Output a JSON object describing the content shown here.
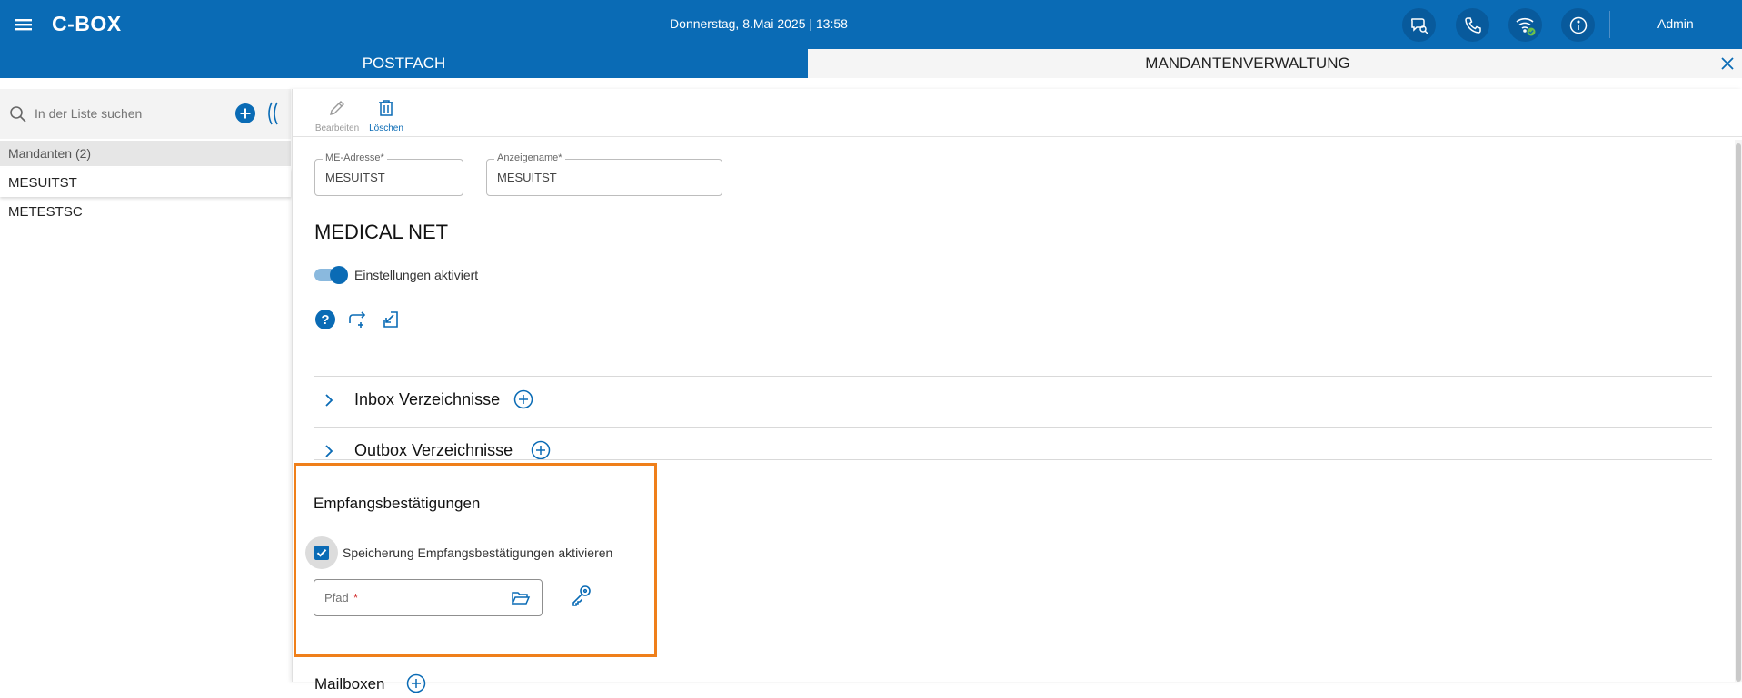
{
  "header": {
    "app_title": "C-BOX",
    "datetime": "Donnerstag, 8.Mai 2025 | 13:58",
    "user": "Admin",
    "icons": [
      "menu-icon",
      "chat-search-icon",
      "phone-icon",
      "wifi-connected-icon",
      "info-icon"
    ]
  },
  "tabs": [
    {
      "label": "POSTFACH",
      "active": false
    },
    {
      "label": "MANDANTENVERWALTUNG",
      "active": true
    }
  ],
  "sidebar": {
    "search_placeholder": "In der Liste suchen",
    "group_label": "Mandanten (2)",
    "items": [
      {
        "label": "MESUITST",
        "selected": true
      },
      {
        "label": "METESTSC",
        "selected": false
      }
    ]
  },
  "toolbar": {
    "edit_label": "Bearbeiten",
    "delete_label": "Löschen"
  },
  "form": {
    "me_address_label": "ME-Adresse*",
    "me_address_value": "MESUITST",
    "display_name_label": "Anzeigename*",
    "display_name_value": "MESUITST",
    "section_title": "MEDICAL NET",
    "settings_toggle_label": "Einstellungen aktiviert",
    "settings_enabled": true
  },
  "accordions": [
    {
      "label": "Inbox Verzeichnisse"
    },
    {
      "label": "Outbox Verzeichnisse"
    }
  ],
  "receipts": {
    "title": "Empfangsbestätigungen",
    "checkbox_label": "Speicherung Empfangsbestätigungen aktivieren",
    "checked": true,
    "path_placeholder": "Pfad",
    "path_required_mark": "*"
  },
  "mailboxen": {
    "title": "Mailboxen"
  },
  "colors": {
    "primary": "#0a6bb5",
    "highlight": "#ef7f1a",
    "wifi_ok": "#6cc04a"
  }
}
